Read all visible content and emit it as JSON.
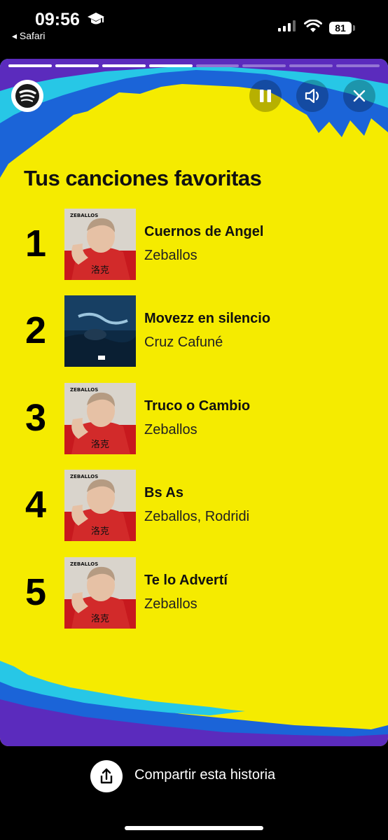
{
  "status_bar": {
    "time": "09:56",
    "back_app": "◂ Safari",
    "battery": "81"
  },
  "story": {
    "progress_total": 8,
    "progress_done": 4,
    "title": "Tus canciones favoritas",
    "tracks": [
      {
        "rank": "1",
        "song": "Cuernos de Angel",
        "artist": "Zeballos"
      },
      {
        "rank": "2",
        "song": "Movezz en silencio",
        "artist": "Cruz Cafuné"
      },
      {
        "rank": "3",
        "song": "Truco o Cambio",
        "artist": "Zeballos"
      },
      {
        "rank": "4",
        "song": "Bs As",
        "artist": "Zeballos, Rodridi"
      },
      {
        "rank": "5",
        "song": "Te lo Advertí",
        "artist": "Zeballos"
      }
    ]
  },
  "share": {
    "label": "Compartir esta historia"
  },
  "colors": {
    "background": "#f5eb00",
    "accent_blue": "#1b64d8",
    "accent_cyan": "#27c7e6",
    "accent_purple": "#5b2bbd"
  },
  "icons": [
    "graduation-cap-icon",
    "signal-icon",
    "wifi-icon",
    "spotify-logo-icon",
    "pause-icon",
    "speaker-icon",
    "close-icon",
    "share-icon"
  ]
}
